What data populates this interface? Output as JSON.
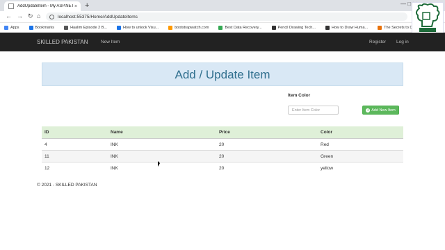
{
  "browser": {
    "tab_title": "AddUpdateItem - My ASP.NET A",
    "tab_close": "×",
    "new_tab": "+",
    "window_controls": "—  □  ✕",
    "url": "localhost:55375/Home/AddUpdateItems",
    "bookmarks": [
      {
        "label": "Apps",
        "color": "#4285f4"
      },
      {
        "label": "Bookmarks",
        "color": "#1a73e8"
      },
      {
        "label": "Haalim Episode 2 B...",
        "color": "#555555"
      },
      {
        "label": "How to unlock Visu...",
        "color": "#1a73e8"
      },
      {
        "label": "bootstrapwatch.com",
        "color": "#ff9900"
      },
      {
        "label": "Best Data Recovery...",
        "color": "#34a853"
      },
      {
        "label": "Pencil Drawing Tech...",
        "color": "#333333"
      },
      {
        "label": "How to Draw Huma...",
        "color": "#333333"
      },
      {
        "label": "The Secrets to Dra...",
        "color": "#e8710a"
      }
    ]
  },
  "navbar": {
    "brand": "SKILLED PAKISTAN",
    "new_item": "New Item",
    "register": "Register",
    "login": "Log in"
  },
  "page": {
    "heading": "Add / Update Item",
    "color_label": "Item Color",
    "color_placeholder": "Enter Item Color",
    "add_button": "Add New Item",
    "add_icon": "+"
  },
  "table": {
    "columns": [
      "ID",
      "Name",
      "Price",
      "Color"
    ],
    "rows": [
      [
        "4",
        "INK",
        "20",
        "Red"
      ],
      [
        "11",
        "INK",
        "20",
        "Green"
      ],
      [
        "12",
        "INK",
        "20",
        "yellow"
      ]
    ]
  },
  "footer": {
    "text": "© 2021 - SKILLED PAKISTAN"
  },
  "colors": {
    "navbar_bg": "#222222",
    "jumbotron_bg": "#d9e8f5",
    "heading_color": "#31708f",
    "table_header_bg": "#dff0d8",
    "button_green": "#5cb85c"
  }
}
